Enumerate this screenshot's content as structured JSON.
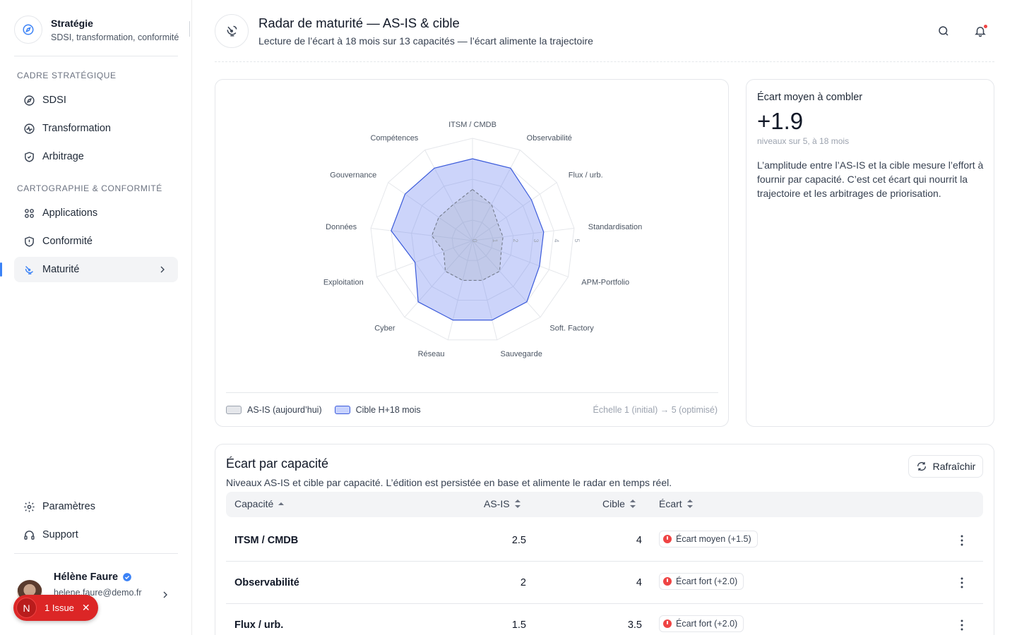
{
  "app": {
    "name": "Stratégie",
    "subtitle": "SDSI, transformation, conformité"
  },
  "sidebar": {
    "section1": "CADRE STRATÉGIQUE",
    "section2": "CARTOGRAPHIE & CONFORMITÉ",
    "items": [
      {
        "label": "SDSI",
        "icon": "compass-icon"
      },
      {
        "label": "Transformation",
        "icon": "activity-icon"
      },
      {
        "label": "Arbitrage",
        "icon": "shield-check-icon"
      },
      {
        "label": "Applications",
        "icon": "apps-grid-icon"
      },
      {
        "label": "Conformité",
        "icon": "shield-alert-icon"
      },
      {
        "label": "Maturité",
        "icon": "radar-icon",
        "active": true
      }
    ],
    "bottom": [
      {
        "label": "Paramètres",
        "icon": "gear-icon"
      },
      {
        "label": "Support",
        "icon": "headset-icon"
      }
    ]
  },
  "user": {
    "name": "Hélène Faure",
    "email": "helene.faure@demo.fr"
  },
  "issue": {
    "badge": "N",
    "label": "1 Issue"
  },
  "header": {
    "title": "Radar de maturité — AS-IS & cible",
    "subtitle": "Lecture de l’écart à 18 mois sur 13 capacités — l’écart alimente la trajectoire"
  },
  "chart_data": {
    "type": "radar",
    "categories": [
      "ITSM / CMDB",
      "Observabilité",
      "Flux / urb.",
      "Standardisation",
      "APM-Portfolio",
      "Soft. Factory",
      "Sauvegarde",
      "Réseau",
      "Cyber",
      "Exploitation",
      "Données",
      "Gouvernance",
      "Compétences"
    ],
    "series": [
      {
        "name": "AS-IS (aujourd’hui)",
        "values": [
          2.5,
          2,
          1.5,
          1.5,
          1.5,
          2,
          2,
          2,
          2,
          1.5,
          2,
          2,
          2
        ],
        "color": "#9ca3af"
      },
      {
        "name": "Cible H+18 mois",
        "values": [
          4,
          4,
          3.5,
          3.5,
          3.5,
          4,
          4,
          4,
          4,
          3,
          4,
          4,
          4
        ],
        "color": "#3b5bdb"
      }
    ],
    "rlim": [
      0,
      5
    ],
    "ticks": [
      "0",
      "1",
      "2",
      "3",
      "4",
      "5"
    ]
  },
  "legend": {
    "asis": "AS-IS (aujourd’hui)",
    "target": "Cible H+18 mois",
    "scale": "Échelle 1 (initial) → 5 (optimisé)"
  },
  "gap": {
    "title": "Écart moyen à combler",
    "value": "+1.9",
    "unit": "niveaux sur 5, à 18 mois",
    "description": "L’amplitude entre l’AS-IS et la cible mesure l’effort à fournir par capacité. C’est cet écart qui nourrit la trajectoire et les arbitrages de priorisation."
  },
  "table": {
    "title": "Écart par capacité",
    "subtitle": "Niveaux AS-IS et cible par capacité. L’édition est persistée en base et alimente le radar en temps réel.",
    "refresh": "Rafraîchir",
    "columns": [
      "Capacité",
      "AS-IS",
      "Cible",
      "Écart"
    ],
    "rows": [
      {
        "capacity": "ITSM / CMDB",
        "asis": "2.5",
        "target": "4",
        "gap": "Écart moyen (+1.5)"
      },
      {
        "capacity": "Observabilité",
        "asis": "2",
        "target": "4",
        "gap": "Écart fort (+2.0)"
      },
      {
        "capacity": "Flux / urb.",
        "asis": "1.5",
        "target": "3.5",
        "gap": "Écart fort (+2.0)"
      }
    ]
  }
}
